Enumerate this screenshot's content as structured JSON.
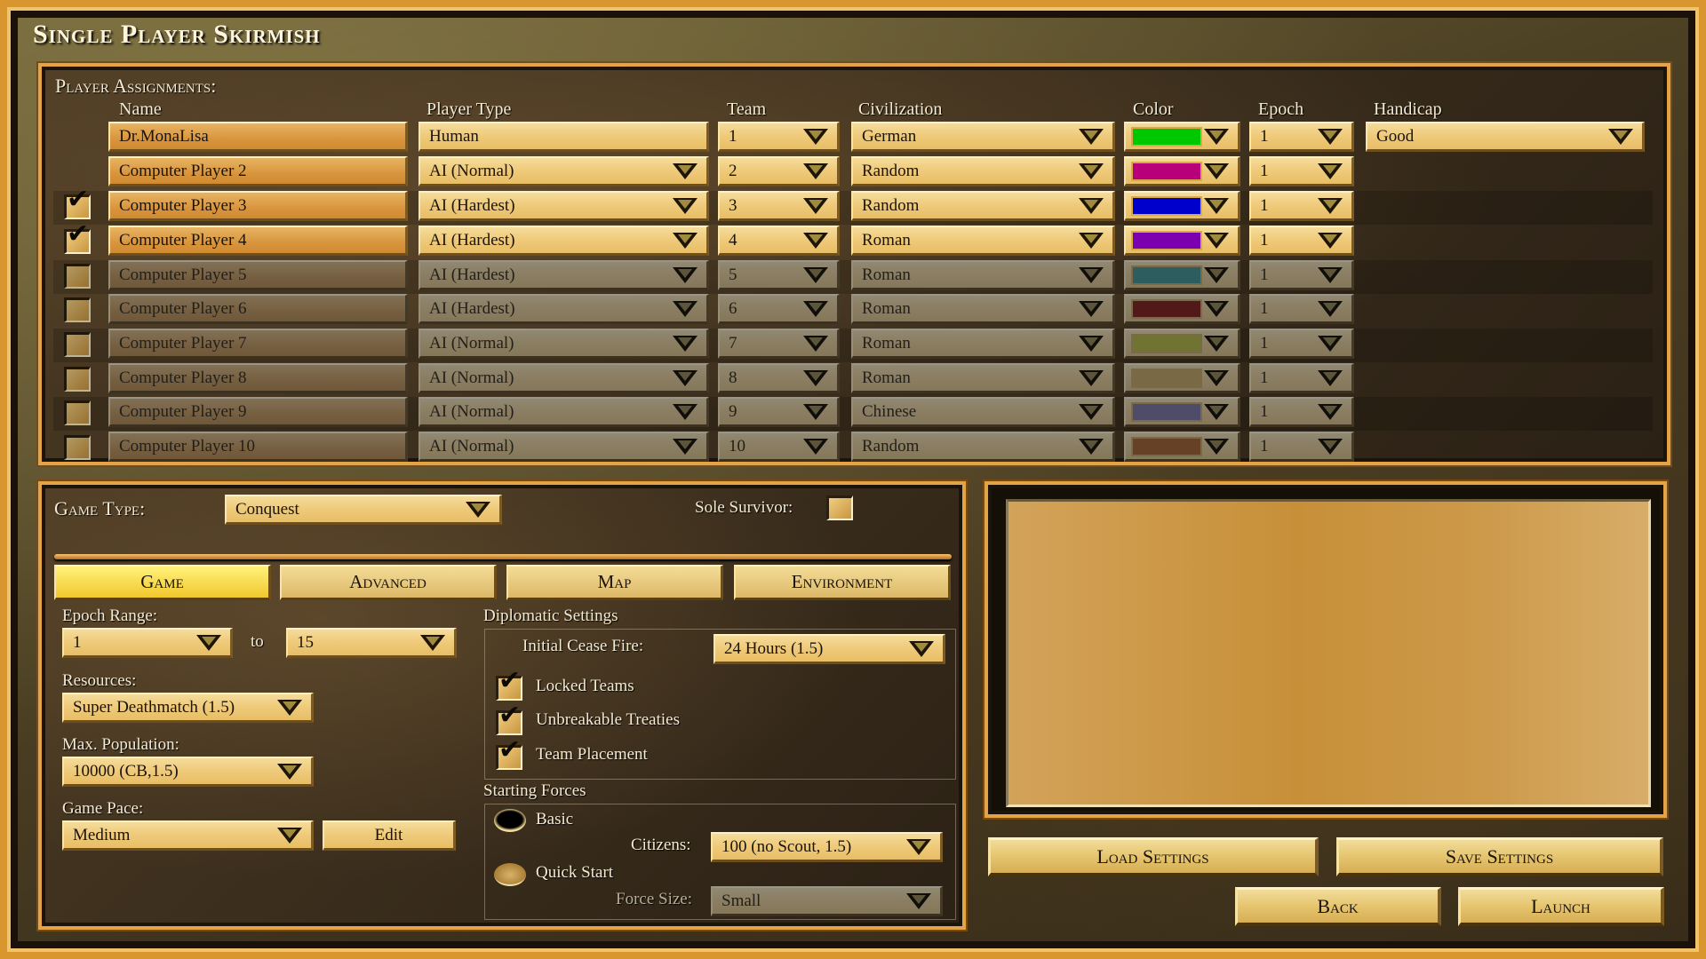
{
  "title": "Single Player Skirmish",
  "player_assignments": {
    "label": "Player Assignments:",
    "columns": [
      "Name",
      "Player Type",
      "Team",
      "Civilization",
      "Color",
      "Epoch",
      "Handicap"
    ],
    "rows": [
      {
        "enabled": true,
        "checkbox": null,
        "name": "Dr.MonaLisa",
        "player_type": "Human",
        "team": "1",
        "civilization": "German",
        "color": "#00c800",
        "epoch": "1",
        "handicap": "Good"
      },
      {
        "enabled": true,
        "checkbox": null,
        "name": "Computer Player 2",
        "player_type": "AI (Normal)",
        "team": "2",
        "civilization": "Random",
        "color": "#b8007a",
        "epoch": "1",
        "handicap": null
      },
      {
        "enabled": true,
        "checkbox": true,
        "name": "Computer Player 3",
        "player_type": "AI (Hardest)",
        "team": "3",
        "civilization": "Random",
        "color": "#0000cc",
        "epoch": "1",
        "handicap": null
      },
      {
        "enabled": true,
        "checkbox": true,
        "name": "Computer Player 4",
        "player_type": "AI (Hardest)",
        "team": "4",
        "civilization": "Roman",
        "color": "#7a00b0",
        "epoch": "1",
        "handicap": null
      },
      {
        "enabled": false,
        "checkbox": false,
        "name": "Computer Player 5",
        "player_type": "AI (Hardest)",
        "team": "5",
        "civilization": "Roman",
        "color": "#1aa3a8",
        "epoch": "1",
        "handicap": null
      },
      {
        "enabled": false,
        "checkbox": false,
        "name": "Computer Player 6",
        "player_type": "AI (Hardest)",
        "team": "6",
        "civilization": "Roman",
        "color": "#c01818",
        "epoch": "1",
        "handicap": null
      },
      {
        "enabled": false,
        "checkbox": false,
        "name": "Computer Player 7",
        "player_type": "AI (Normal)",
        "team": "7",
        "civilization": "Roman",
        "color": "#b8c000",
        "epoch": "1",
        "handicap": null
      },
      {
        "enabled": false,
        "checkbox": false,
        "name": "Computer Player 8",
        "player_type": "AI (Normal)",
        "team": "8",
        "civilization": "Roman",
        "color": "#d8a840",
        "epoch": "1",
        "handicap": null
      },
      {
        "enabled": false,
        "checkbox": false,
        "name": "Computer Player 9",
        "player_type": "AI (Normal)",
        "team": "9",
        "civilization": "Chinese",
        "color": "#7c78c8",
        "epoch": "1",
        "handicap": null
      },
      {
        "enabled": false,
        "checkbox": false,
        "name": "Computer Player 10",
        "player_type": "AI (Normal)",
        "team": "10",
        "civilization": "Random",
        "color": "#d06010",
        "epoch": "1",
        "handicap": null
      }
    ]
  },
  "game_type": {
    "label": "Game Type:",
    "value": "Conquest",
    "sole_survivor_label": "Sole Survivor:",
    "sole_survivor_checked": false
  },
  "tabs": [
    {
      "label": "Game",
      "active": true
    },
    {
      "label": "Advanced",
      "active": false
    },
    {
      "label": "Map",
      "active": false
    },
    {
      "label": "Environment",
      "active": false
    }
  ],
  "game_settings": {
    "epoch_range_label": "Epoch Range:",
    "epoch_from": "1",
    "epoch_to_label": "to",
    "epoch_to": "15",
    "resources_label": "Resources:",
    "resources": "Super Deathmatch (1.5)",
    "max_population_label": "Max. Population:",
    "max_population": "10000 (CB,1.5)",
    "game_pace_label": "Game Pace:",
    "game_pace": "Medium",
    "edit_label": "Edit"
  },
  "diplomatic": {
    "title": "Diplomatic Settings",
    "cease_fire_label": "Initial Cease Fire:",
    "cease_fire": "24 Hours (1.5)",
    "options": [
      {
        "label": "Locked Teams",
        "checked": true
      },
      {
        "label": "Unbreakable Treaties",
        "checked": true
      },
      {
        "label": "Team Placement",
        "checked": true
      }
    ]
  },
  "starting_forces": {
    "title": "Starting Forces",
    "basic_label": "Basic",
    "basic_selected": true,
    "citizens_label": "Citizens:",
    "citizens": "100 (no Scout, 1.5)",
    "quick_start_label": "Quick Start",
    "quick_start_selected": false,
    "force_size_label": "Force Size:",
    "force_size": "Small"
  },
  "buttons": {
    "load_settings": "Load Settings",
    "save_settings": "Save Settings",
    "back": "Back",
    "launch": "Launch"
  }
}
